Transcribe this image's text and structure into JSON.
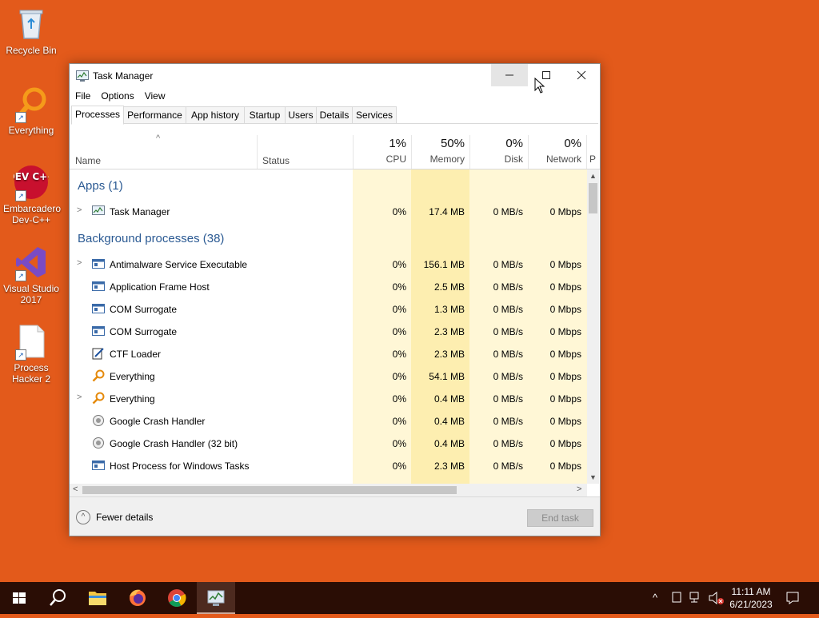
{
  "desktop": {
    "icons": [
      {
        "label": "Recycle Bin"
      },
      {
        "label": "Everything"
      },
      {
        "label": "Embarcadero Dev-C++"
      },
      {
        "label": "Visual Studio 2017"
      },
      {
        "label": "Process Hacker 2"
      }
    ],
    "devcpp_logo_text": "DEV C++"
  },
  "window": {
    "title": "Task Manager",
    "menu": [
      "File",
      "Options",
      "View"
    ],
    "tabs": [
      "Processes",
      "Performance",
      "App history",
      "Startup",
      "Users",
      "Details",
      "Services"
    ],
    "active_tab": "Processes",
    "columns": {
      "name": "Name",
      "status": "Status",
      "cpu_pct": "1%",
      "cpu": "CPU",
      "memory_pct": "50%",
      "memory": "Memory",
      "disk_pct": "0%",
      "disk": "Disk",
      "network_pct": "0%",
      "network": "Network",
      "next_col_partial": "P"
    },
    "groups": {
      "apps": "Apps (1)",
      "background": "Background processes (38)"
    },
    "app_rows": [
      {
        "name": "Task Manager",
        "cpu": "0%",
        "memory": "17.4 MB",
        "disk": "0 MB/s",
        "network": "0 Mbps",
        "expandable": true
      }
    ],
    "bg_rows": [
      {
        "name": "Antimalware Service Executable",
        "cpu": "0%",
        "memory": "156.1 MB",
        "disk": "0 MB/s",
        "network": "0 Mbps",
        "expandable": true
      },
      {
        "name": "Application Frame Host",
        "cpu": "0%",
        "memory": "2.5 MB",
        "disk": "0 MB/s",
        "network": "0 Mbps",
        "expandable": false
      },
      {
        "name": "COM Surrogate",
        "cpu": "0%",
        "memory": "1.3 MB",
        "disk": "0 MB/s",
        "network": "0 Mbps",
        "expandable": false
      },
      {
        "name": "COM Surrogate",
        "cpu": "0%",
        "memory": "2.3 MB",
        "disk": "0 MB/s",
        "network": "0 Mbps",
        "expandable": false
      },
      {
        "name": "CTF Loader",
        "cpu": "0%",
        "memory": "2.3 MB",
        "disk": "0 MB/s",
        "network": "0 Mbps",
        "expandable": false
      },
      {
        "name": "Everything",
        "cpu": "0%",
        "memory": "54.1 MB",
        "disk": "0 MB/s",
        "network": "0 Mbps",
        "expandable": false
      },
      {
        "name": "Everything",
        "cpu": "0%",
        "memory": "0.4 MB",
        "disk": "0 MB/s",
        "network": "0 Mbps",
        "expandable": true
      },
      {
        "name": "Google Crash Handler",
        "cpu": "0%",
        "memory": "0.4 MB",
        "disk": "0 MB/s",
        "network": "0 Mbps",
        "expandable": false
      },
      {
        "name": "Google Crash Handler (32 bit)",
        "cpu": "0%",
        "memory": "0.4 MB",
        "disk": "0 MB/s",
        "network": "0 Mbps",
        "expandable": false
      },
      {
        "name": "Host Process for Windows Tasks",
        "cpu": "0%",
        "memory": "2.3 MB",
        "disk": "0 MB/s",
        "network": "0 Mbps",
        "expandable": false
      }
    ],
    "footer": {
      "fewer_details": "Fewer details",
      "end_task": "End task"
    }
  },
  "taskbar": {
    "time": "11:11 AM",
    "date": "6/21/2023"
  },
  "colors": {
    "desktop": "#e35a1b",
    "taskbar": "#2a0d05",
    "group_title": "#2b5a93",
    "heat_light": "#fff7d6",
    "heat_memory": "#fdeeb0"
  }
}
